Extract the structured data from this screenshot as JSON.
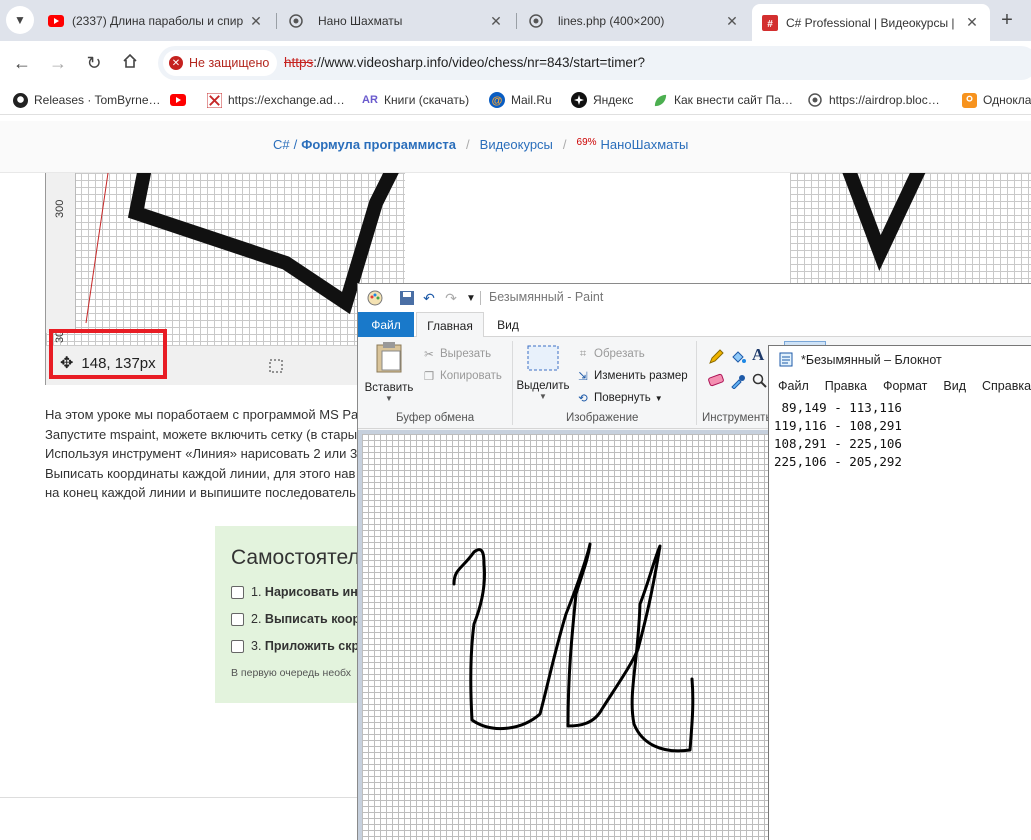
{
  "browser": {
    "tabs": [
      {
        "title": "(2337) Длина параболы и спир",
        "icon": "youtube-icon",
        "active": false
      },
      {
        "title": "Нано Шахматы",
        "icon": "globe-icon",
        "active": false
      },
      {
        "title": "lines.php (400×200)",
        "icon": "globe-icon",
        "active": false
      },
      {
        "title": "C# Professional | Видеокурсы |",
        "icon": "csharp-site-icon",
        "active": true
      }
    ],
    "security_label": "Не защищено",
    "url_scheme": "https",
    "url_rest": "://www.videosharp.info/video/chess/nr=843/start=timer?",
    "bookmarks": [
      {
        "label": "Releases · TomByrne…",
        "icon": "github-icon"
      },
      {
        "label": "",
        "icon": "youtube-icon"
      },
      {
        "label": "https://exchange.ad…",
        "icon": "exchange-icon"
      },
      {
        "label": "Книги (скачать)",
        "icon": "ar-icon"
      },
      {
        "label": "Mail.Ru",
        "icon": "mailru-icon"
      },
      {
        "label": "Яндекс",
        "icon": "yandex-icon"
      },
      {
        "label": "Как внести сайт Па…",
        "icon": "leaf-icon"
      },
      {
        "label": "https://airdrop.bloc…",
        "icon": "globe-icon"
      },
      {
        "label": "Однокла",
        "icon": "ok-icon"
      }
    ]
  },
  "site": {
    "nav": {
      "csharp": "C#",
      "formula": "Формула программиста",
      "courses": "Видеокурсы",
      "percent": "69%",
      "project": "НаноШахматы"
    },
    "screenshot": {
      "ruler_label": "300",
      "ruler_label_2": "30",
      "coords": "148, 137px"
    },
    "article_lines": [
      "На этом уроке мы поработаем с программой MS Pa",
      "Запустите mspaint, можете включить сетку (в стары",
      "Используя инструмент «Линия» нарисовать 2 или 3",
      "Выписать координаты каждой линии, для этого нав",
      "на конец каждой линии и выпишите последователь"
    ],
    "task": {
      "heading": "Самостоятел",
      "items": [
        {
          "num": "1.",
          "text": "Нарисовать ини"
        },
        {
          "num": "2.",
          "text": "Выписать коорд"
        },
        {
          "num": "3.",
          "text": "Приложить скр"
        }
      ],
      "note": "В первую очередь необх"
    }
  },
  "paint": {
    "title": "Безымянный - Paint",
    "tabs": {
      "file": "Файл",
      "home": "Главная",
      "view": "Вид"
    },
    "clipboard": {
      "paste": "Вставить",
      "cut": "Вырезать",
      "copy": "Копировать",
      "group": "Буфер обмена"
    },
    "image": {
      "select": "Выделить",
      "crop": "Обрезать",
      "resize": "Изменить размер",
      "rotate": "Повернуть",
      "group": "Изображение"
    },
    "tools": {
      "group": "Инструменты"
    }
  },
  "notepad": {
    "title": "*Безымянный – Блокнот",
    "menu": [
      "Файл",
      "Правка",
      "Формат",
      "Вид",
      "Справка"
    ],
    "lines": [
      " 89,149 - 113,116",
      "119,116 - 108,291",
      "108,291 - 225,106",
      "225,106 - 205,292"
    ]
  }
}
